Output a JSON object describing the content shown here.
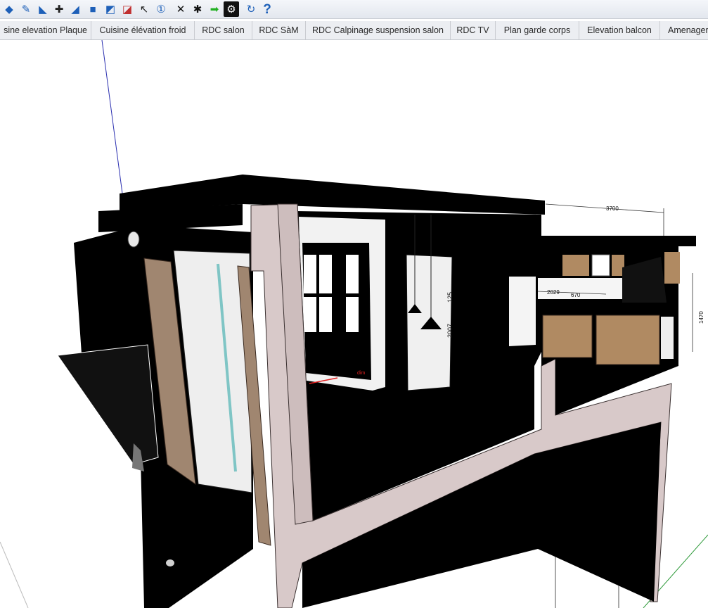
{
  "toolbar": {
    "tools": [
      {
        "name": "walk-icon",
        "glyph": "◆"
      },
      {
        "name": "pencil-icon",
        "glyph": "✎"
      },
      {
        "name": "tape-measure-icon",
        "glyph": "◣"
      },
      {
        "name": "axes-icon",
        "glyph": "✚"
      },
      {
        "name": "section-plane-icon",
        "glyph": "◢"
      },
      {
        "name": "cube-icon",
        "glyph": "■"
      },
      {
        "name": "paint-icon",
        "glyph": "◩"
      },
      {
        "name": "eraser-icon",
        "glyph": "◪"
      },
      {
        "name": "select-arrow-icon",
        "glyph": "↖"
      },
      {
        "name": "numbering-icon",
        "glyph": "①"
      },
      {
        "name": "close-x-icon",
        "glyph": "✕"
      },
      {
        "name": "explode-icon",
        "glyph": "✱"
      },
      {
        "name": "green-arrow-icon",
        "glyph": "➡"
      },
      {
        "name": "component-icon",
        "glyph": "⚙"
      },
      {
        "name": "refresh-icon",
        "glyph": "↻"
      },
      {
        "name": "help-icon",
        "glyph": "?"
      }
    ]
  },
  "tabs": [
    {
      "label": "sine elevation Plaque"
    },
    {
      "label": "Cuisine élévation froid"
    },
    {
      "label": "RDC salon"
    },
    {
      "label": "RDC SàM"
    },
    {
      "label": "RDC Calpinage suspension salon"
    },
    {
      "label": "RDC TV"
    },
    {
      "label": "Plan garde corps"
    },
    {
      "label": "Elevation balcon"
    },
    {
      "label": "Amenager"
    }
  ],
  "dimensions": {
    "top_width": "3700",
    "kitchen_a": "2029",
    "kitchen_b": "670",
    "kitchen_height": "1470",
    "window_height": "2007",
    "window_small": "125"
  },
  "colors": {
    "wall_section": "#d8c9c9",
    "wall_edge": "#3a3030",
    "wood": "#a08670",
    "kitchen_wood": "#b08a62",
    "dimension_line": "#333333",
    "axis_blue": "#2a2fb0",
    "axis_green": "#2e9a3a",
    "red_marker": "#e02020"
  }
}
